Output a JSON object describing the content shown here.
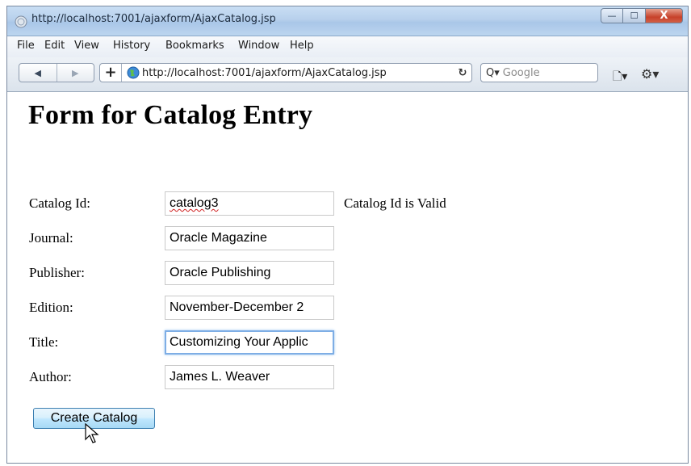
{
  "window": {
    "title": "http://localhost:7001/ajaxform/AjaxCatalog.jsp",
    "minimize_glyph": "—",
    "maximize_glyph": "☐",
    "close_glyph": "X"
  },
  "menu": [
    "File",
    "Edit",
    "View",
    "History",
    "Bookmarks",
    "Window",
    "Help"
  ],
  "navbar": {
    "back_glyph": "◀",
    "forward_glyph": "▶",
    "add_glyph": "+",
    "url": "http://localhost:7001/ajaxform/AjaxCatalog.jsp",
    "reload_glyph": "↻",
    "search_placeholder": "Google",
    "search_glyph": "Q▾",
    "page_menu_glyph": "🗋▾",
    "settings_glyph": "⚙▾"
  },
  "page": {
    "heading": "Form for Catalog Entry",
    "fields": [
      {
        "label": "Catalog Id:",
        "value": "catalog3"
      },
      {
        "label": "Journal:",
        "value": "Oracle Magazine"
      },
      {
        "label": "Publisher:",
        "value": "Oracle Publishing"
      },
      {
        "label": "Edition:",
        "value": "November-December 2"
      },
      {
        "label": "Title:",
        "value": "Customizing Your Applic"
      },
      {
        "label": "Author:",
        "value": "James L. Weaver"
      }
    ],
    "catalog_status": "Catalog Id is Valid",
    "submit_label": "Create Catalog"
  },
  "colors": {
    "titlebar": "#b7d0ec",
    "focus_border": "#7eaee5",
    "button_border": "#3c7fb1"
  },
  "icons": [
    "browser-favicon",
    "globe-icon",
    "reload-icon",
    "search-icon",
    "page-icon",
    "gear-icon",
    "mouse-cursor-icon"
  ]
}
